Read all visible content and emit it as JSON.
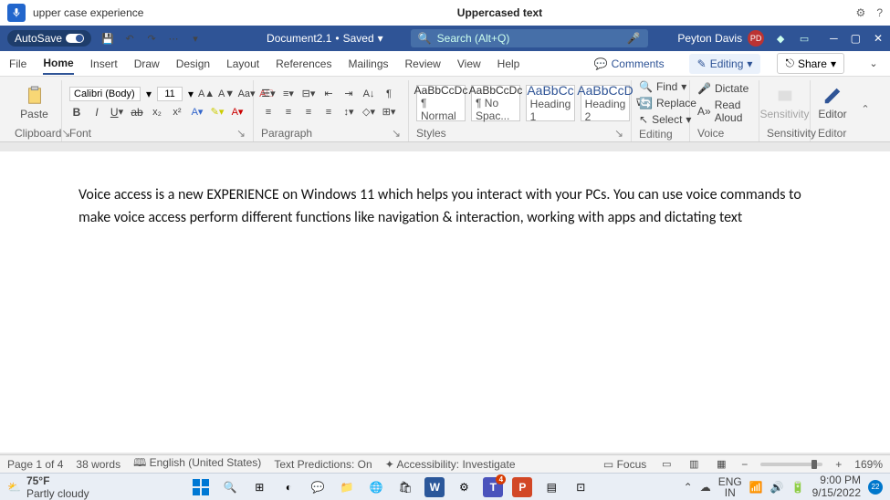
{
  "voice": {
    "command": "upper case experience",
    "result": "Uppercased text"
  },
  "title": {
    "autosave": "AutoSave",
    "doc": "Document2.1",
    "saved": "Saved",
    "search_ph": "Search (Alt+Q)",
    "user": "Peyton Davis",
    "initials": "PD"
  },
  "menu": {
    "tabs": [
      "File",
      "Home",
      "Insert",
      "Draw",
      "Design",
      "Layout",
      "References",
      "Mailings",
      "Review",
      "View",
      "Help"
    ],
    "active": 1,
    "comments": "Comments",
    "editing": "Editing",
    "share": "Share"
  },
  "ribbon": {
    "clipboard": {
      "paste": "Paste",
      "label": "Clipboard"
    },
    "font": {
      "name": "Calibri (Body)",
      "size": "11",
      "label": "Font"
    },
    "paragraph": {
      "label": "Paragraph"
    },
    "styles": {
      "label": "Styles",
      "items": [
        {
          "sample": "AaBbCcDc",
          "name": "¶ Normal"
        },
        {
          "sample": "AaBbCcDc",
          "name": "¶ No Spac..."
        },
        {
          "sample": "AaBbCc",
          "name": "Heading 1"
        },
        {
          "sample": "AaBbCcD",
          "name": "Heading 2"
        }
      ]
    },
    "editing": {
      "find": "Find",
      "replace": "Replace",
      "select": "Select",
      "label": "Editing"
    },
    "voice": {
      "dictate": "Dictate",
      "read": "Read Aloud",
      "label": "Voice"
    },
    "sensitivity": {
      "btn": "Sensitivity",
      "label": "Sensitivity"
    },
    "editor": {
      "btn": "Editor",
      "label": "Editor"
    }
  },
  "document": {
    "body": "Voice access is a new EXPERIENCE on Windows 11 which helps you interact with your PCs. You can use voice commands to make voice access perform different functions like navigation & interaction, working with apps and dictating text"
  },
  "status": {
    "page": "Page 1 of 4",
    "words": "38 words",
    "lang": "English (United States)",
    "pred": "Text Predictions: On",
    "acc": "Accessibility: Investigate",
    "focus": "Focus",
    "zoom": "169%"
  },
  "taskbar": {
    "temp": "75°F",
    "cond": "Partly cloudy",
    "lang": "ENG",
    "region": "IN",
    "time": "9:00 PM",
    "date": "9/15/2022",
    "notif": "22",
    "teams_badge": "4"
  }
}
